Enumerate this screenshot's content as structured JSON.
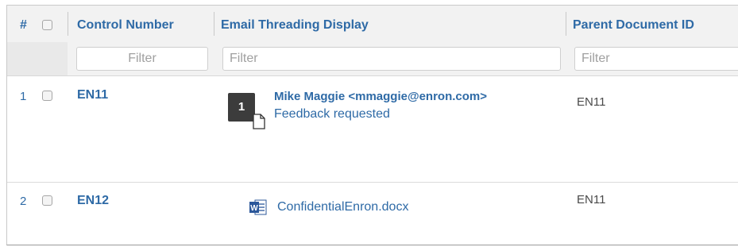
{
  "columns": {
    "number": "#",
    "control_number": "Control Number",
    "email_threading": "Email Threading Display",
    "parent_document_id": "Parent Document ID"
  },
  "filters": {
    "control_number_placeholder": "Filter",
    "email_threading_placeholder": "Filter",
    "parent_document_id_placeholder": "Filter"
  },
  "rows": [
    {
      "number": "1",
      "control_number": "EN11",
      "thread_count": "1",
      "sender": "Mike Maggie <mmaggie@enron.com>",
      "subject": "Feedback requested",
      "parent_document_id": "EN11",
      "checked": false
    },
    {
      "number": "2",
      "control_number": "EN12",
      "attachment_name": "ConfidentialEnron.docx",
      "attachment_icon": "word-doc-icon",
      "parent_document_id": "EN11",
      "checked": false
    }
  ],
  "colors": {
    "link": "#2e6aa6",
    "header_bg": "#f2f2f2",
    "badge_bg": "#3c3c3c",
    "word_blue": "#2b579a"
  }
}
